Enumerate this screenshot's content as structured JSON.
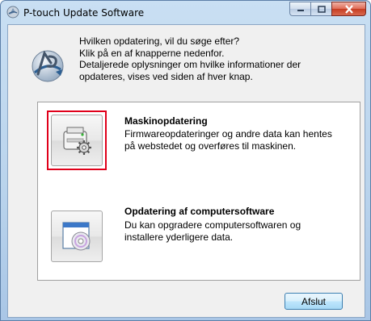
{
  "window": {
    "title": "P-touch Update Software"
  },
  "header": {
    "lines": [
      "Hvilken opdatering, vil du søge efter?",
      "Klik på en af knapperne nedenfor.",
      "Detaljerede oplysninger om hvilke informationer der",
      "opdateres, vises ved siden af hver knap."
    ]
  },
  "options": [
    {
      "title": "Maskinopdatering",
      "description": [
        "Firmwareopdateringer og andre data kan hentes",
        "på webstedet og overføres til maskinen."
      ],
      "icon": "machine-update-icon",
      "highlighted": true
    },
    {
      "title": "Opdatering af computersoftware",
      "description": [
        "Du kan opgradere computersoftwaren og",
        "installere yderligere data."
      ],
      "icon": "software-update-icon",
      "highlighted": false
    }
  ],
  "footer": {
    "close_label": "Afslut"
  },
  "colors": {
    "highlight": "#e0001a",
    "window_frame": "#b9d3ec",
    "close_caption": "#c63d22"
  }
}
